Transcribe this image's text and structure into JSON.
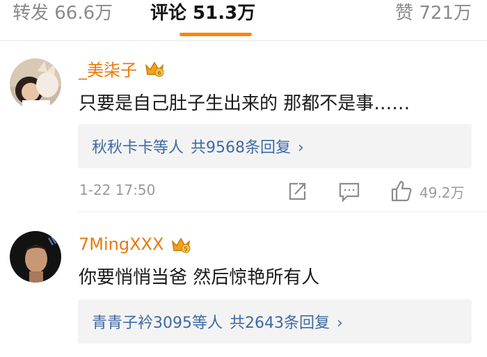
{
  "tabs": {
    "repost": "转发 66.6万",
    "comment": "评论 51.3万",
    "like": "赞 721万",
    "active": "comment",
    "accent": "#ff8200"
  },
  "comments": [
    {
      "username": "_美柒子",
      "badge_icon": "crown-icon",
      "text": "只要是自己肚子生出来的 那都不是事……",
      "reply_users": "秋秋卡卡等人",
      "reply_count": "共9568条回复",
      "reply_chevron": "›",
      "timestamp": "1-22 17:50",
      "like_count": "49.2万"
    },
    {
      "username": "7MingXXX",
      "badge_icon": "crown-icon",
      "text": "你要悄悄当爸 然后惊艳所有人",
      "reply_users": "青青子衿3095等人",
      "reply_count": "共2643条回复",
      "reply_chevron": "›"
    }
  ],
  "colors": {
    "username": "#e8790c",
    "reply_link": "#3d6aa3",
    "muted": "#9a9a9a"
  }
}
